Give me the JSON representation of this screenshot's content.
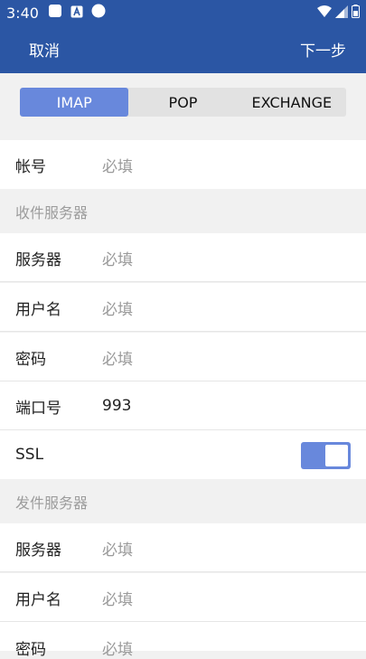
{
  "status_bar": {
    "time": "3:40",
    "icons": [
      "notification-square-icon",
      "app-a-icon",
      "circle-icon",
      "wifi-icon",
      "signal-icon",
      "battery-icon"
    ]
  },
  "appbar": {
    "cancel_label": "取消",
    "next_label": "下一步"
  },
  "protocol_tabs": {
    "options": [
      "IMAP",
      "POP",
      "EXCHANGE"
    ],
    "selected": "IMAP"
  },
  "account": {
    "label": "帐号",
    "placeholder": "必填"
  },
  "incoming": {
    "section_title": "收件服务器",
    "server": {
      "label": "服务器",
      "placeholder": "必填"
    },
    "username": {
      "label": "用户名",
      "placeholder": "必填"
    },
    "password": {
      "label": "密码",
      "placeholder": "必填"
    },
    "port": {
      "label": "端口号",
      "value": "993"
    },
    "ssl": {
      "label": "SSL",
      "enabled": true
    }
  },
  "outgoing": {
    "section_title": "发件服务器",
    "server": {
      "label": "服务器",
      "placeholder": "必填"
    },
    "username": {
      "label": "用户名",
      "placeholder": "必填"
    },
    "password": {
      "label": "密码",
      "placeholder": "必填"
    }
  },
  "colors": {
    "primary": "#2b56a4",
    "accent": "#6888dc"
  }
}
